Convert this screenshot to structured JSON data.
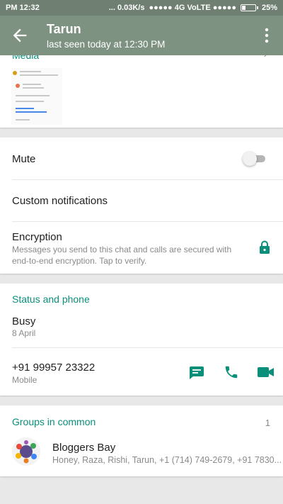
{
  "status_bar": {
    "time": "PM 12:32",
    "network": "... 0.03K/s",
    "signal": "●●●●● 4G VoLTE ●●●●●",
    "battery": "25%",
    "battery_level": 0.25
  },
  "header": {
    "title": "Tarun",
    "subtitle": "last seen today at 12:30 PM"
  },
  "media": {
    "title": "Media",
    "arrow": "›"
  },
  "settings": {
    "mute_label": "Mute",
    "mute_on": false,
    "custom_notifications_label": "Custom notifications",
    "encryption_label": "Encryption",
    "encryption_text": "Messages you send to this chat and calls are secured with end-to-end encryption. Tap to verify."
  },
  "status_phone": {
    "section_title": "Status and phone",
    "status": "Busy",
    "status_date": "8 April",
    "phone": "+91 99957 23322",
    "phone_type": "Mobile"
  },
  "groups": {
    "section_title": "Groups in common",
    "count": "1",
    "items": [
      {
        "name": "Bloggers Bay",
        "members": "Honey, Raza, Rishi, Tarun, +1 (714) 749-2679, +91 7830..."
      }
    ]
  },
  "colors": {
    "accent": "#0a8f7a",
    "appbar": "#7e9281",
    "statusbar": "#6f7f72"
  },
  "icons": [
    "back-arrow-icon",
    "more-vert-icon",
    "lock-icon",
    "message-icon",
    "phone-icon",
    "video-icon"
  ]
}
